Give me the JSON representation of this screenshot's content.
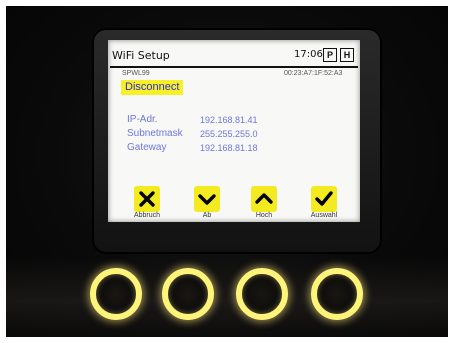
{
  "header": {
    "title": "WiFi Setup",
    "time": "17:06",
    "indicator_p": "P",
    "indicator_h": "H"
  },
  "network": {
    "ssid": "SPWL99",
    "mac": "00:23:A7:1F:52:A3",
    "disconnect_label": "Disconnect",
    "ip_label": "IP-Adr.",
    "ip_value": "192.168.81.41",
    "subnet_label": "Subnetmask",
    "subnet_value": "255.255.255.0",
    "gateway_label": "Gateway",
    "gateway_value": "192.168.81.18"
  },
  "softkeys": [
    {
      "label": "Abbruch",
      "icon": "close-icon"
    },
    {
      "label": "Ab",
      "icon": "chevron-down-icon"
    },
    {
      "label": "Hoch",
      "icon": "chevron-up-icon"
    },
    {
      "label": "Auswahl",
      "icon": "check-icon"
    }
  ],
  "colors": {
    "softkey_bg": "#f3ea1f",
    "highlight_bg": "#f7ef2a",
    "info_text": "#6c78d8",
    "ring_glow": "#fff47a"
  }
}
